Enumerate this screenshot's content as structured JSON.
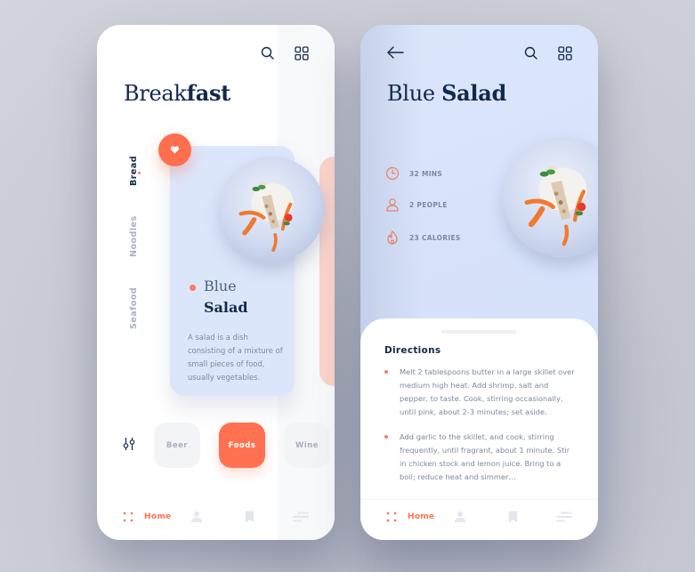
{
  "colors": {
    "accent": "#ff7151",
    "navy": "#13294b",
    "muted": "#a7b0c3",
    "card_blue": "#dce6fb",
    "peach": "#fbd4cb"
  },
  "left_screen": {
    "header": {
      "search_icon": "search-icon",
      "grid_icon": "grid-icon"
    },
    "title": {
      "light": "Break",
      "bold": "fast"
    },
    "categories": [
      {
        "label": "Bread",
        "active": true
      },
      {
        "label": "Noodles",
        "active": false
      },
      {
        "label": "Seafood",
        "active": false
      }
    ],
    "featured_card": {
      "title_light": "Blue",
      "title_bold": "Salad",
      "description": "A salad is a dish consisting of a mixture of small pieces of food, usually vegetables.",
      "favorite_icon": "heart-icon"
    },
    "filters": {
      "icon": "sliders-icon",
      "chips": [
        {
          "label": "Beer",
          "active": false
        },
        {
          "label": "Foods",
          "active": true
        },
        {
          "label": "Wine",
          "active": false
        }
      ]
    },
    "bottom_nav": {
      "items": [
        {
          "icon": "home-dots-icon",
          "label": "Home",
          "active": true
        },
        {
          "icon": "profile-icon",
          "label": "",
          "active": false
        },
        {
          "icon": "bookmark-icon",
          "label": "",
          "active": false
        },
        {
          "icon": "menu-lines-icon",
          "label": "",
          "active": false
        }
      ]
    }
  },
  "right_screen": {
    "header": {
      "back_icon": "arrow-left-icon",
      "search_icon": "search-icon",
      "grid_icon": "grid-icon"
    },
    "title": {
      "light": "Blue",
      "bold": "Salad"
    },
    "stats": [
      {
        "icon": "clock-icon",
        "label": "32 MINS"
      },
      {
        "icon": "person-icon",
        "label": "2 PEOPLE"
      },
      {
        "icon": "flame-icon",
        "label": "23 CALORIES"
      }
    ],
    "directions": {
      "heading": "Directions",
      "steps": [
        "Melt 2 tablespoons butter in a large skillet over medium high heat. Add shrimp, salt and pepper, to taste. Cook, stirring occasionally, until pink, about 2-3 minutes; set aside.",
        "Add garlic to the skillet, and cook, stirring frequently, until fragrant, about 1 minute. Stir in chicken stock and lemon juice. Bring to a boil; reduce heat and simmer…"
      ]
    },
    "bottom_nav": {
      "items": [
        {
          "icon": "home-dots-icon",
          "label": "Home",
          "active": true
        },
        {
          "icon": "profile-icon",
          "label": "",
          "active": false
        },
        {
          "icon": "bookmark-icon",
          "label": "",
          "active": false
        },
        {
          "icon": "menu-lines-icon",
          "label": "",
          "active": false
        }
      ]
    }
  }
}
